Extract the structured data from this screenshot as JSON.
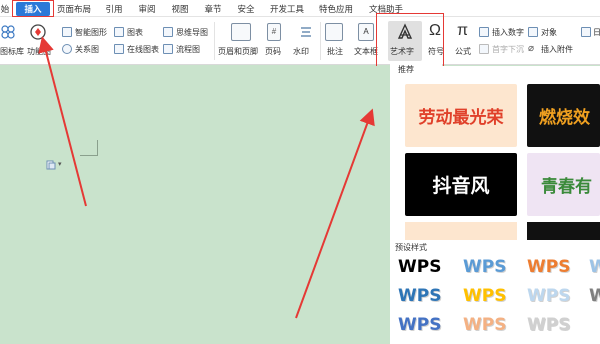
{
  "menu": {
    "items": [
      "始",
      "插入",
      "页面布局",
      "引用",
      "审阅",
      "视图",
      "章节",
      "安全",
      "开发工具",
      "特色应用",
      "文档助手"
    ],
    "active": "插入"
  },
  "ribbon": {
    "icon_lib": "图标库",
    "function_map": "功能图",
    "smart_shape": "智能图形",
    "chart": "图表",
    "mind_map": "思维导图",
    "relation_map": "关系图",
    "online_chart": "在线图表",
    "flowchart": "流程图",
    "header_footer": "页眉和页脚",
    "page_number": "页码",
    "watermark": "水印",
    "comment": "批注",
    "textbox": "文本框",
    "wordart": "艺术字",
    "symbol": "符号",
    "formula": "公式",
    "insert_number": "插入数字",
    "object": "对象",
    "first_char_sink": "首字下沉",
    "insert_attachment": "插入附件",
    "date_partial": "日"
  },
  "dropdown": {
    "tab": "推荐",
    "cards": [
      {
        "text": "劳动最光荣",
        "color": "#e0402a",
        "bg": "#fde6cf"
      },
      {
        "text": "燃烧效",
        "color": "#f0a020",
        "bg": "#111111"
      },
      {
        "text": "抖音风",
        "color": "#ffffff",
        "bg": "#000000"
      },
      {
        "text": "青春有",
        "color": "#3a8a3a",
        "bg": "#efe4f3"
      }
    ],
    "preset_title": "预设样式",
    "presets": [
      {
        "text": "WPS",
        "color": "#000000"
      },
      {
        "text": "WPS",
        "color": "#5b9bd5"
      },
      {
        "text": "WPS",
        "color": "#ed7d31"
      },
      {
        "text": "W",
        "color": "#9dc3e6"
      },
      {
        "text": "WPS",
        "color": "#2e75b6"
      },
      {
        "text": "WPS",
        "color": "#ffc000"
      },
      {
        "text": "WPS",
        "color": "#bdd7ee"
      },
      {
        "text": "W",
        "color": "#7f7f7f"
      },
      {
        "text": "WPS",
        "color": "#4472c4"
      },
      {
        "text": "WPS",
        "color": "#f4b183"
      },
      {
        "text": "WPS",
        "color": "#d0d0d0"
      }
    ]
  },
  "colors": {
    "accent": "#2b79d8",
    "highlight": "#e53935",
    "arrow": "#e53935",
    "document_bg": "#c9e3cc"
  }
}
